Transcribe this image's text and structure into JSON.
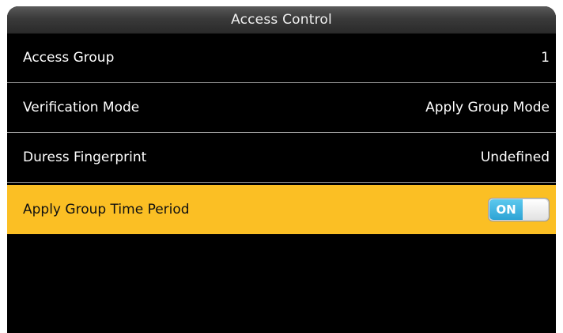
{
  "header": {
    "title": "Access Control"
  },
  "menu": {
    "items": [
      {
        "label": "Access Group",
        "value": "1"
      },
      {
        "label": "Verification Mode",
        "value": "Apply Group Mode"
      },
      {
        "label": "Duress Fingerprint",
        "value": "Undefined"
      },
      {
        "label": "Apply Group Time Period",
        "value": "ON",
        "state": "on",
        "selected": true
      }
    ]
  },
  "colors": {
    "screen_background": "#000000",
    "selection_highlight": "#fbbf24",
    "toggle_on": "#2ea3d4"
  }
}
